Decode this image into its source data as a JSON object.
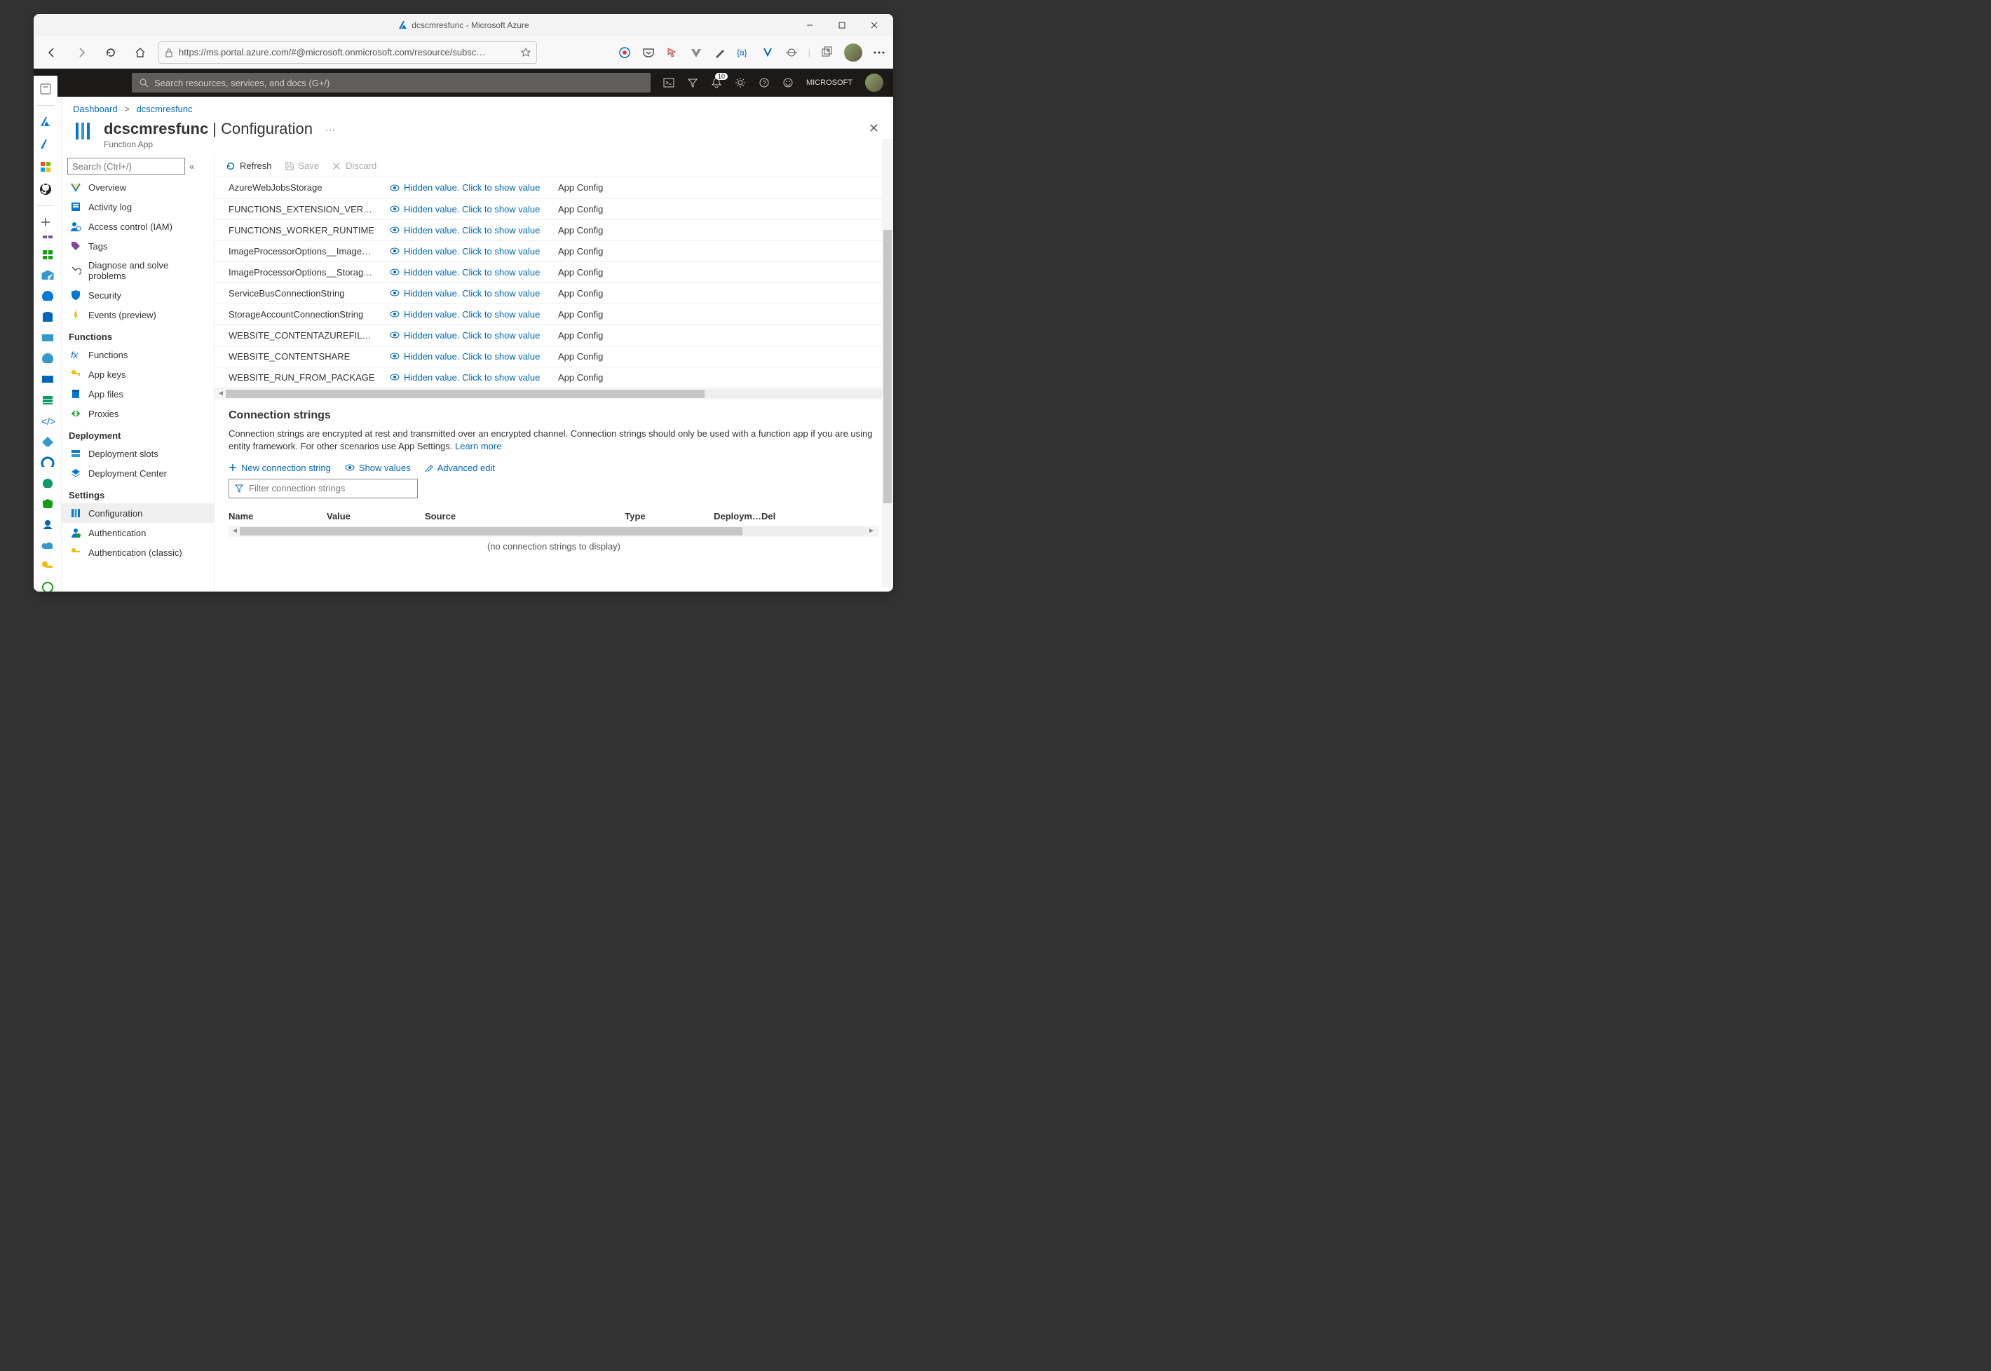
{
  "window": {
    "title": "dcscmresfunc - Microsoft Azure"
  },
  "browser": {
    "url": "https://ms.portal.azure.com/#@microsoft.onmicrosoft.com/resource/subsc…"
  },
  "azure": {
    "search_placeholder": "Search resources, services, and docs (G+/)",
    "notification_count": "10",
    "account": "MICROSOFT"
  },
  "breadcrumb": {
    "root": "Dashboard",
    "current": "dcscmresfunc"
  },
  "header": {
    "title_bold": "dcscmresfunc",
    "title_rest": " | Configuration",
    "subtitle": "Function App"
  },
  "sidemenu": {
    "search_placeholder": "Search (Ctrl+/)",
    "items_top": [
      "Overview",
      "Activity log",
      "Access control (IAM)",
      "Tags",
      "Diagnose and solve problems",
      "Security",
      "Events (preview)"
    ],
    "sec_functions": "Functions",
    "items_functions": [
      "Functions",
      "App keys",
      "App files",
      "Proxies"
    ],
    "sec_deploy": "Deployment",
    "items_deploy": [
      "Deployment slots",
      "Deployment Center"
    ],
    "sec_settings": "Settings",
    "items_settings": [
      "Configuration",
      "Authentication",
      "Authentication (classic)"
    ]
  },
  "toolbar": {
    "refresh": "Refresh",
    "save": "Save",
    "discard": "Discard"
  },
  "appsettings": {
    "hidden_text": "Hidden value. Click to show value",
    "source": "App Config",
    "rows": [
      "AzureWebJobsStorage",
      "FUNCTIONS_EXTENSION_VERSION",
      "FUNCTIONS_WORKER_RUNTIME",
      "ImageProcessorOptions__ImageWidth",
      "ImageProcessorOptions__StorageAccountCon",
      "ServiceBusConnectionString",
      "StorageAccountConnectionString",
      "WEBSITE_CONTENTAZUREFILECONNECTIONS",
      "WEBSITE_CONTENTSHARE",
      "WEBSITE_RUN_FROM_PACKAGE"
    ]
  },
  "connection_strings": {
    "heading": "Connection strings",
    "desc": "Connection strings are encrypted at rest and transmitted over an encrypted channel. Connection strings should only be used with a function app if you are using entity framework. For other scenarios use App Settings. ",
    "learn": "Learn more",
    "new": "New connection string",
    "show": "Show values",
    "adv": "Advanced edit",
    "filter_placeholder": "Filter connection strings",
    "cols": [
      "Name",
      "Value",
      "Source",
      "Type",
      "Deploym…",
      "Del"
    ],
    "empty": "(no connection strings to display)"
  }
}
